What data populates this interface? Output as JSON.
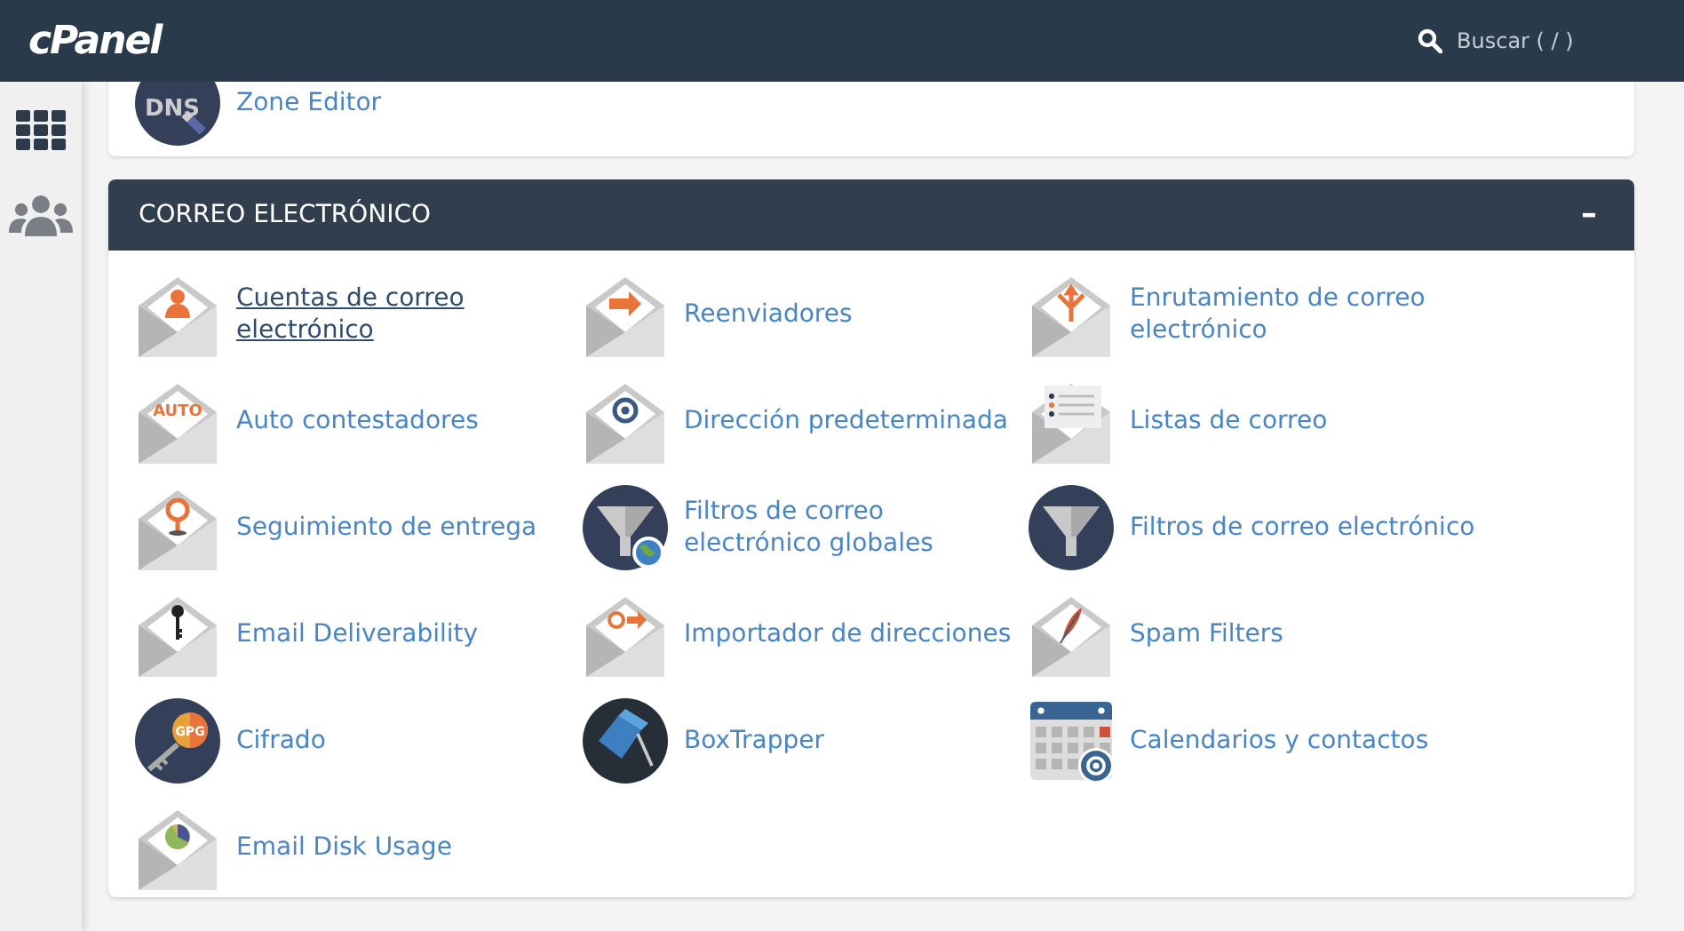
{
  "header": {
    "logo": "cPanel",
    "search": {
      "placeholder": "Buscar ( / )"
    }
  },
  "sidebar": {
    "items": [
      {
        "kind": "grid",
        "selected": true
      },
      {
        "kind": "users",
        "selected": false
      }
    ]
  },
  "previous_section": {
    "items": [
      {
        "label": "Zone Editor",
        "kind": "dns",
        "icon_text": "DNS"
      }
    ]
  },
  "section": {
    "title": "CORREO ELECTRÓNICO",
    "toggle": "–",
    "expanded": true,
    "items": [
      {
        "label": "Cuentas de correo electrónico",
        "kind": "env-person",
        "hovered": true
      },
      {
        "label": "Reenviadores",
        "kind": "env-arrow",
        "hovered": false
      },
      {
        "label": "Enrutamiento de correo electrónico",
        "kind": "env-route",
        "hovered": false
      },
      {
        "label": "Auto contestadores",
        "kind": "env-auto",
        "icon_text": "AUTO",
        "hovered": false
      },
      {
        "label": "Dirección predeterminada",
        "kind": "env-at",
        "hovered": false
      },
      {
        "label": "Listas de correo",
        "kind": "env-list",
        "hovered": false
      },
      {
        "label": "Seguimiento de entrega",
        "kind": "env-pin",
        "hovered": false
      },
      {
        "label": "Filtros de correo electrónico globales",
        "kind": "funnel-globe",
        "hovered": false
      },
      {
        "label": "Filtros de correo electrónico",
        "kind": "funnel",
        "hovered": false
      },
      {
        "label": "Email Deliverability",
        "kind": "env-key",
        "hovered": false
      },
      {
        "label": "Importador de direcciones",
        "kind": "env-at-arrow",
        "hovered": false
      },
      {
        "label": "Spam Filters",
        "kind": "env-feather",
        "hovered": false
      },
      {
        "label": "Cifrado",
        "kind": "gpg-key",
        "icon_text": "GPG",
        "hovered": false
      },
      {
        "label": "BoxTrapper",
        "kind": "box",
        "hovered": false
      },
      {
        "label": "Calendarios y contactos",
        "kind": "calendar",
        "hovered": false
      },
      {
        "label": "Email Disk Usage",
        "kind": "env-pie",
        "hovered": false
      }
    ]
  }
}
